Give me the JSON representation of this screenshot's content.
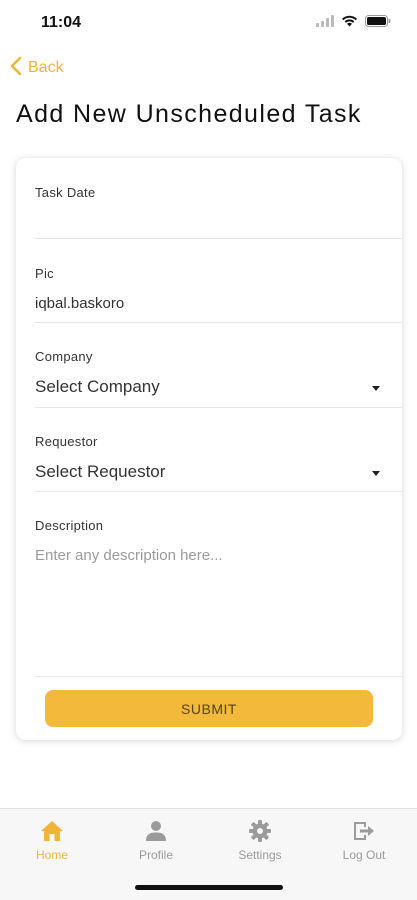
{
  "status_bar": {
    "time": "11:04"
  },
  "header": {
    "back_label": "Back",
    "title": "Add New Unscheduled Task"
  },
  "form": {
    "task_date": {
      "label": "Task Date",
      "value": ""
    },
    "pic": {
      "label": "Pic",
      "value": "iqbal.baskoro"
    },
    "company": {
      "label": "Company",
      "selected": "Select Company"
    },
    "requestor": {
      "label": "Requestor",
      "selected": "Select Requestor"
    },
    "description": {
      "label": "Description",
      "placeholder": "Enter any description here..."
    },
    "submit_label": "SUBMIT"
  },
  "tabs": [
    {
      "label": "Home",
      "icon": "home-icon",
      "active": true
    },
    {
      "label": "Profile",
      "icon": "person-icon",
      "active": false
    },
    {
      "label": "Settings",
      "icon": "gear-icon",
      "active": false
    },
    {
      "label": "Log Out",
      "icon": "logout-icon",
      "active": false
    }
  ],
  "colors": {
    "accent": "#F0B43A",
    "submit_bg": "#F3B93A",
    "tab_inactive": "#9B9B9B"
  }
}
